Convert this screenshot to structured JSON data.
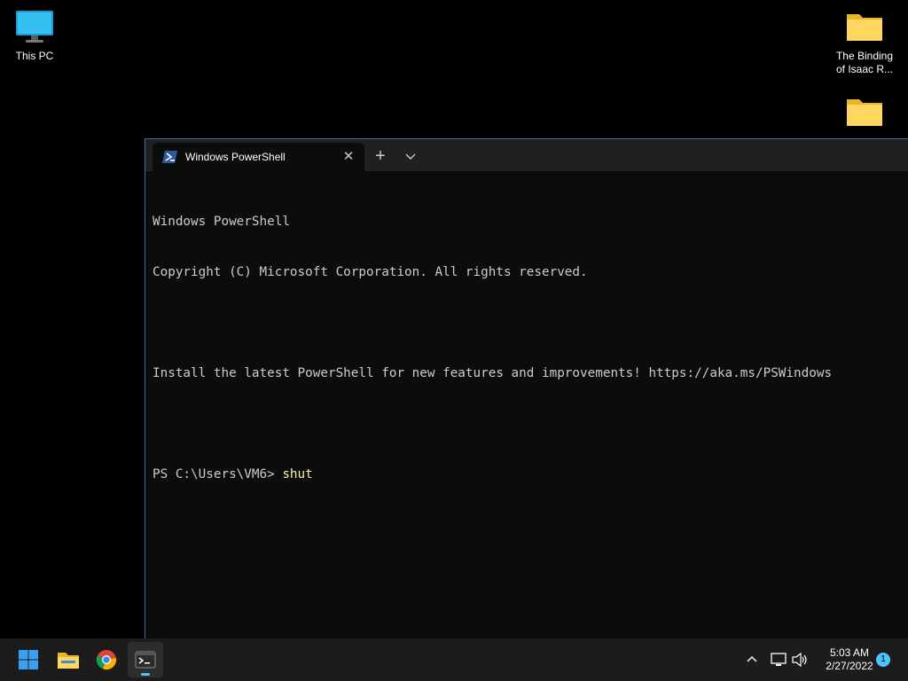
{
  "desktop": {
    "icons": [
      {
        "label": "This PC",
        "icon": "monitor-icon"
      },
      {
        "label_line1": "The Binding",
        "label_line2": "of Isaac R...",
        "icon": "folder-icon"
      },
      {
        "label": "",
        "icon": "folder-icon"
      }
    ]
  },
  "terminal": {
    "tab_title": "Windows PowerShell",
    "tab_icon": "powershell-icon",
    "lines": [
      "Windows PowerShell",
      "Copyright (C) Microsoft Corporation. All rights reserved.",
      "",
      "Install the latest PowerShell for new features and improvements! https://aka.ms/PSWindows",
      ""
    ],
    "prompt": "PS C:\\Users\\VM6> ",
    "command": "shut"
  },
  "taskbar": {
    "apps": [
      "windows-start-icon",
      "file-explorer-icon",
      "chrome-icon",
      "terminal-icon"
    ],
    "time": "5:03 AM",
    "date": "2/27/2022",
    "notification_count": "1"
  },
  "colors": {
    "accent": "#4cc2ff",
    "terminal_bg": "#0c0c0c",
    "command_text": "#f9f1a5"
  }
}
